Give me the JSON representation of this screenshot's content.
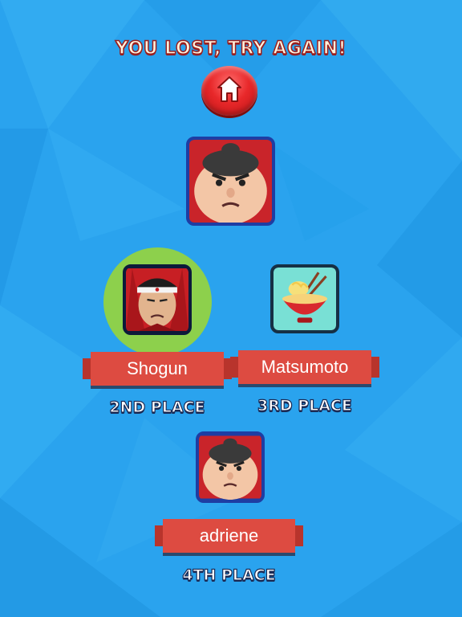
{
  "screen": {
    "title": "YOU LOST, TRY AGAIN!",
    "home_icon": "home-icon",
    "colors": {
      "background": "#2aa3ee",
      "banner": "#dd4b41",
      "halo": "#8dd04c",
      "button": "#e8282a"
    }
  },
  "winner": {
    "avatar": "sumo-wrestler"
  },
  "players": [
    {
      "name": "Shogun",
      "place": "2ND PLACE",
      "avatar": "shogun-headband",
      "highlighted": true
    },
    {
      "name": "Matsumoto",
      "place": "3RD PLACE",
      "avatar": "noodle-bowl",
      "highlighted": false
    },
    {
      "name": "adriene",
      "place": "4TH PLACE",
      "avatar": "sumo-wrestler",
      "highlighted": false
    }
  ]
}
